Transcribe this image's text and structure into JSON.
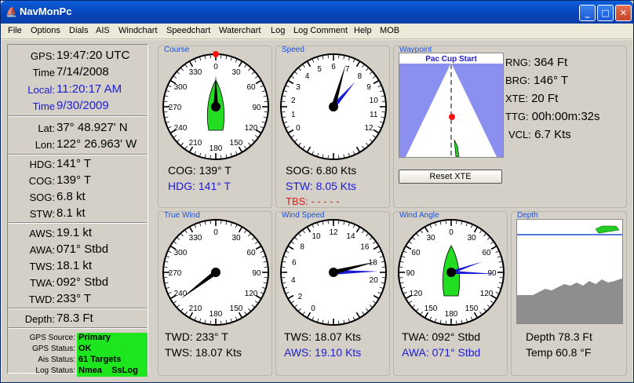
{
  "window": {
    "title": "NavMonPc"
  },
  "menu": [
    "File",
    "Options",
    "Dials",
    "AIS",
    "Windchart",
    "Speedchart",
    "Waterchart",
    "Log",
    "Log Comment",
    "Help",
    "MOB"
  ],
  "left": {
    "gps_label": "GPS:",
    "gps_value": "19:47:20 UTC",
    "time_label": "Time",
    "time_value": "7/14/2008",
    "local_label": "Local:",
    "local_value": "11:20:17 AM",
    "time2_label": "Time",
    "time2_value": "9/30/2009",
    "lat_label": "Lat:",
    "lat_value": "37° 48.927' N",
    "lon_label": "Lon:",
    "lon_value": "122° 26.963' W",
    "hdg_label": "HDG:",
    "hdg_value": "141° T",
    "cog_label": "COG:",
    "cog_value": "139° T",
    "sog_label": "SOG:",
    "sog_value": "6.8 kt",
    "stw_label": "STW:",
    "stw_value": "8.1 kt",
    "aws_label": "AWS:",
    "aws_value": "19.1 kt",
    "awa_label": "AWA:",
    "awa_value": "071° Stbd",
    "tws_label": "TWS:",
    "tws_value": "18.1 kt",
    "twa_label": "TWA:",
    "twa_value": "092° Stbd",
    "twd_label": "TWD:",
    "twd_value": "233° T",
    "depth_label": "Depth:",
    "depth_value": "78.3 Ft"
  },
  "status": [
    {
      "label": "GPS Source:",
      "value": "Primary"
    },
    {
      "label": "GPS Status:",
      "value": "OK"
    },
    {
      "label": "Ais Status:",
      "value": "61 Targets"
    },
    {
      "label": "Log Status:",
      "value": "Nmea    SsLog"
    }
  ],
  "course": {
    "title": "Course",
    "cog_label": "COG:",
    "cog_value": "139° T",
    "hdg_label": "HDG:",
    "hdg_value": "141° T",
    "ticks": [
      "0",
      "30",
      "60",
      "90",
      "120",
      "150",
      "180",
      "210",
      "240",
      "270",
      "300",
      "330"
    ],
    "heading": 141
  },
  "speed": {
    "title": "Speed",
    "sog_label": "SOG:",
    "sog_value": "6.80 Kts",
    "stw_label": "STW:",
    "stw_value": "8.05 Kts",
    "tbs_label": "TBS:",
    "tbs_value": "- - - - -",
    "ticks": [
      "0",
      "1",
      "2",
      "3",
      "4",
      "5",
      "6",
      "7",
      "8",
      "9",
      "10",
      "11",
      "12"
    ],
    "sog": 6.8,
    "stw": 8.05
  },
  "waypoint": {
    "title": "Waypoint",
    "name": "Pac Cup Start",
    "reset_label": "Reset XTE",
    "rng_label": "RNG:",
    "rng_value": "364 Ft",
    "brg_label": "BRG:",
    "brg_value": "146° T",
    "xte_label": "XTE:",
    "xte_value": "20 Ft",
    "ttg_label": "TTG:",
    "ttg_value": "00h:00m:32s",
    "vcl_label": "VCL:",
    "vcl_value": "6.7 Kts"
  },
  "truewind": {
    "title": "True Wind",
    "twd_label": "TWD:",
    "twd_value": "233° T",
    "tws_label": "TWS:",
    "tws_value": "18.07 Kts",
    "ticks": [
      "0",
      "30",
      "60",
      "90",
      "120",
      "150",
      "180",
      "210",
      "240",
      "270",
      "300",
      "330"
    ],
    "twd": 233
  },
  "windspeed": {
    "title": "Wind Speed",
    "tws_label": "TWS:",
    "tws_value": "18.07 Kts",
    "aws_label": "AWS:",
    "aws_value": "19.10 Kts",
    "ticks": [
      "0",
      "2",
      "4",
      "6",
      "8",
      "10",
      "12",
      "14",
      "16",
      "18",
      "20"
    ],
    "tws": 18.07,
    "aws": 19.1
  },
  "windangle": {
    "title": "Wind Angle",
    "twa_label": "TWA:",
    "twa_value": "092° Stbd",
    "awa_label": "AWA:",
    "awa_value": "071° Stbd",
    "ticks": [
      "0",
      "30",
      "60",
      "90",
      "120",
      "150",
      "180",
      "150",
      "120",
      "90",
      "60",
      "30"
    ],
    "twa": 92,
    "awa": 71
  },
  "depth": {
    "title": "Depth",
    "depth_label": "Depth",
    "depth_value": "78.3 Ft",
    "temp_label": "Temp",
    "temp_value": "60.8 °F"
  },
  "colors": {
    "accent_blue": "#1b1bd6",
    "status_green": "#1ee61e",
    "boat_green": "#22dd22",
    "alert_red": "#e01b1b"
  }
}
